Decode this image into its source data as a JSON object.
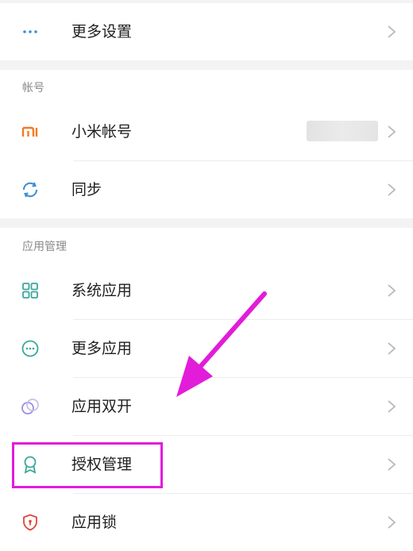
{
  "rows": {
    "more_settings": {
      "label": "更多设置",
      "icon": "more-dots-icon"
    },
    "mi_account": {
      "label": "小米帐号",
      "icon": "mi-logo-icon"
    },
    "sync": {
      "label": "同步",
      "icon": "sync-icon"
    },
    "system_apps": {
      "label": "系统应用",
      "icon": "grid-icon"
    },
    "more_apps": {
      "label": "更多应用",
      "icon": "more-circle-icon"
    },
    "dual_apps": {
      "label": "应用双开",
      "icon": "dual-circle-icon"
    },
    "permissions": {
      "label": "授权管理",
      "icon": "badge-icon"
    },
    "app_lock": {
      "label": "应用锁",
      "icon": "shield-lock-icon"
    }
  },
  "sections": {
    "account": "帐号",
    "app_management": "应用管理"
  },
  "colors": {
    "accent_teal": "#3aa79a",
    "mi_orange": "#f47a21",
    "sync_blue": "#3b8ed6",
    "annotation_magenta": "#e21cd9",
    "lock_red": "#e0463c"
  }
}
